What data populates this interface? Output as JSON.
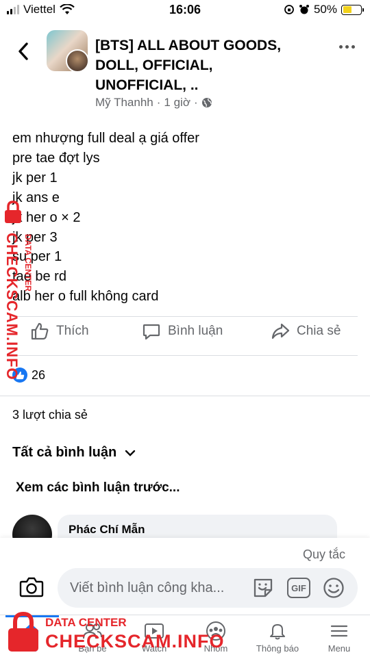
{
  "status_bar": {
    "carrier": "Viettel",
    "time": "16:06",
    "battery": "50%"
  },
  "header": {
    "group_title_lines": [
      "[BTS] ALL ABOUT GOODS,",
      "DOLL, OFFICIAL,",
      "UNOFFICIAL, .."
    ],
    "author": "Mỹ Thanhh",
    "time_ago": "1 giờ",
    "separator": "·"
  },
  "post": {
    "lines": [
      "em nhượng full deal ạ giá offer",
      "pre tae đợt lys",
      "jk per 1",
      "jk ans e",
      "jk her o × 2",
      "jk per 3",
      "su per 1",
      "tae be rd",
      "alb her o full không card"
    ]
  },
  "actions": {
    "like": "Thích",
    "comment": "Bình luận",
    "share": "Chia sẻ"
  },
  "reactions": {
    "count": "26"
  },
  "shares_label": "3 lượt chia sẻ",
  "comments": {
    "filter_label": "Tất cả bình luận",
    "view_previous": "Xem các bình luận trước...",
    "first_author": "Phác Chí Mẫn"
  },
  "composer": {
    "rules": "Quy tắc",
    "placeholder": "Viết bình luận công kha..."
  },
  "bottom_nav": [
    {
      "label": "Tin"
    },
    {
      "label": "Bạn bè"
    },
    {
      "label": "Watch"
    },
    {
      "label": "Nhóm"
    },
    {
      "label": "Thông báo"
    },
    {
      "label": "Menu"
    }
  ],
  "watermark": {
    "main": "CHECKSCAM.INFO",
    "sub": "DATA CENTER"
  },
  "colors": {
    "accent": "#1877f2",
    "watermark": "#e5262b",
    "muted": "#65676b"
  },
  "icons": [
    "back-icon",
    "more-icon",
    "globe-icon",
    "like-icon",
    "comment-icon",
    "share-icon",
    "camera-icon",
    "sticker-icon",
    "gif-icon",
    "emoji-icon",
    "home-icon",
    "friends-icon",
    "watch-icon",
    "groups-icon",
    "bell-icon",
    "menu-icon",
    "lock-icon"
  ]
}
